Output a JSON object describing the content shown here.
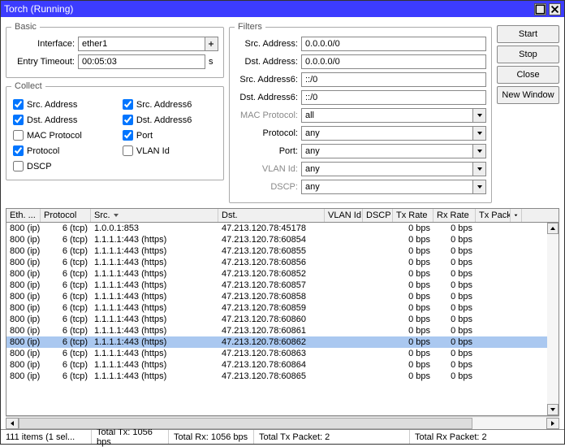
{
  "title": "Torch (Running)",
  "buttons": {
    "start": "Start",
    "stop": "Stop",
    "close": "Close",
    "newWindow": "New Window"
  },
  "basic": {
    "legend": "Basic",
    "interfaceLabel": "Interface:",
    "interface": "ether1",
    "entryTimeoutLabel": "Entry Timeout:",
    "entryTimeout": "00:05:03",
    "entryTimeoutSuffix": "s"
  },
  "collect": {
    "legend": "Collect",
    "srcAddress": "Src. Address",
    "dstAddress": "Dst. Address",
    "macProtocol": "MAC Protocol",
    "protocol": "Protocol",
    "dscp": "DSCP",
    "srcAddress6": "Src. Address6",
    "dstAddress6": "Dst. Address6",
    "port": "Port",
    "vlanId": "VLAN Id"
  },
  "filters": {
    "legend": "Filters",
    "srcAddressLabel": "Src. Address:",
    "srcAddress": "0.0.0.0/0",
    "dstAddressLabel": "Dst. Address:",
    "dstAddress": "0.0.0.0/0",
    "srcAddress6Label": "Src. Address6:",
    "srcAddress6": "::/0",
    "dstAddress6Label": "Dst. Address6:",
    "dstAddress6": "::/0",
    "macProtocolLabel": "MAC Protocol:",
    "macProtocol": "all",
    "protocolLabel": "Protocol:",
    "protocol": "any",
    "portLabel": "Port:",
    "port": "any",
    "vlanIdLabel": "VLAN Id:",
    "vlanId": "any",
    "dscpLabel": "DSCP:",
    "dscp": "any"
  },
  "columns": {
    "eth": "Eth. ...",
    "protocol": "Protocol",
    "src": "Src.",
    "dst": "Dst.",
    "vlanId": "VLAN Id",
    "dscp": "DSCP",
    "txRate": "Tx Rate",
    "rxRate": "Rx Rate",
    "txPacket": "Tx Pack..."
  },
  "rows": [
    {
      "eth": "800 (ip)",
      "proto": "6 (tcp)",
      "src": "1.0.0.1:853",
      "dst": "47.213.120.78:45178",
      "tx": "0 bps",
      "rx": "0 bps",
      "sel": false
    },
    {
      "eth": "800 (ip)",
      "proto": "6 (tcp)",
      "src": "1.1.1.1:443 (https)",
      "dst": "47.213.120.78:60854",
      "tx": "0 bps",
      "rx": "0 bps",
      "sel": false
    },
    {
      "eth": "800 (ip)",
      "proto": "6 (tcp)",
      "src": "1.1.1.1:443 (https)",
      "dst": "47.213.120.78:60855",
      "tx": "0 bps",
      "rx": "0 bps",
      "sel": false
    },
    {
      "eth": "800 (ip)",
      "proto": "6 (tcp)",
      "src": "1.1.1.1:443 (https)",
      "dst": "47.213.120.78:60856",
      "tx": "0 bps",
      "rx": "0 bps",
      "sel": false
    },
    {
      "eth": "800 (ip)",
      "proto": "6 (tcp)",
      "src": "1.1.1.1:443 (https)",
      "dst": "47.213.120.78:60852",
      "tx": "0 bps",
      "rx": "0 bps",
      "sel": false
    },
    {
      "eth": "800 (ip)",
      "proto": "6 (tcp)",
      "src": "1.1.1.1:443 (https)",
      "dst": "47.213.120.78:60857",
      "tx": "0 bps",
      "rx": "0 bps",
      "sel": false
    },
    {
      "eth": "800 (ip)",
      "proto": "6 (tcp)",
      "src": "1.1.1.1:443 (https)",
      "dst": "47.213.120.78:60858",
      "tx": "0 bps",
      "rx": "0 bps",
      "sel": false
    },
    {
      "eth": "800 (ip)",
      "proto": "6 (tcp)",
      "src": "1.1.1.1:443 (https)",
      "dst": "47.213.120.78:60859",
      "tx": "0 bps",
      "rx": "0 bps",
      "sel": false
    },
    {
      "eth": "800 (ip)",
      "proto": "6 (tcp)",
      "src": "1.1.1.1:443 (https)",
      "dst": "47.213.120.78:60860",
      "tx": "0 bps",
      "rx": "0 bps",
      "sel": false
    },
    {
      "eth": "800 (ip)",
      "proto": "6 (tcp)",
      "src": "1.1.1.1:443 (https)",
      "dst": "47.213.120.78:60861",
      "tx": "0 bps",
      "rx": "0 bps",
      "sel": false
    },
    {
      "eth": "800 (ip)",
      "proto": "6 (tcp)",
      "src": "1.1.1.1:443 (https)",
      "dst": "47.213.120.78:60862",
      "tx": "0 bps",
      "rx": "0 bps",
      "sel": true
    },
    {
      "eth": "800 (ip)",
      "proto": "6 (tcp)",
      "src": "1.1.1.1:443 (https)",
      "dst": "47.213.120.78:60863",
      "tx": "0 bps",
      "rx": "0 bps",
      "sel": false
    },
    {
      "eth": "800 (ip)",
      "proto": "6 (tcp)",
      "src": "1.1.1.1:443 (https)",
      "dst": "47.213.120.78:60864",
      "tx": "0 bps",
      "rx": "0 bps",
      "sel": false
    },
    {
      "eth": "800 (ip)",
      "proto": "6 (tcp)",
      "src": "1.1.1.1:443 (https)",
      "dst": "47.213.120.78:60865",
      "tx": "0 bps",
      "rx": "0 bps",
      "sel": false
    }
  ],
  "status": {
    "items": "111 items (1 sel...",
    "totalTx": "Total Tx: 1056 bps",
    "totalRx": "Total Rx: 1056 bps",
    "totalTxPacket": "Total Tx Packet: 2",
    "totalRxPacket": "Total Rx Packet: 2"
  }
}
